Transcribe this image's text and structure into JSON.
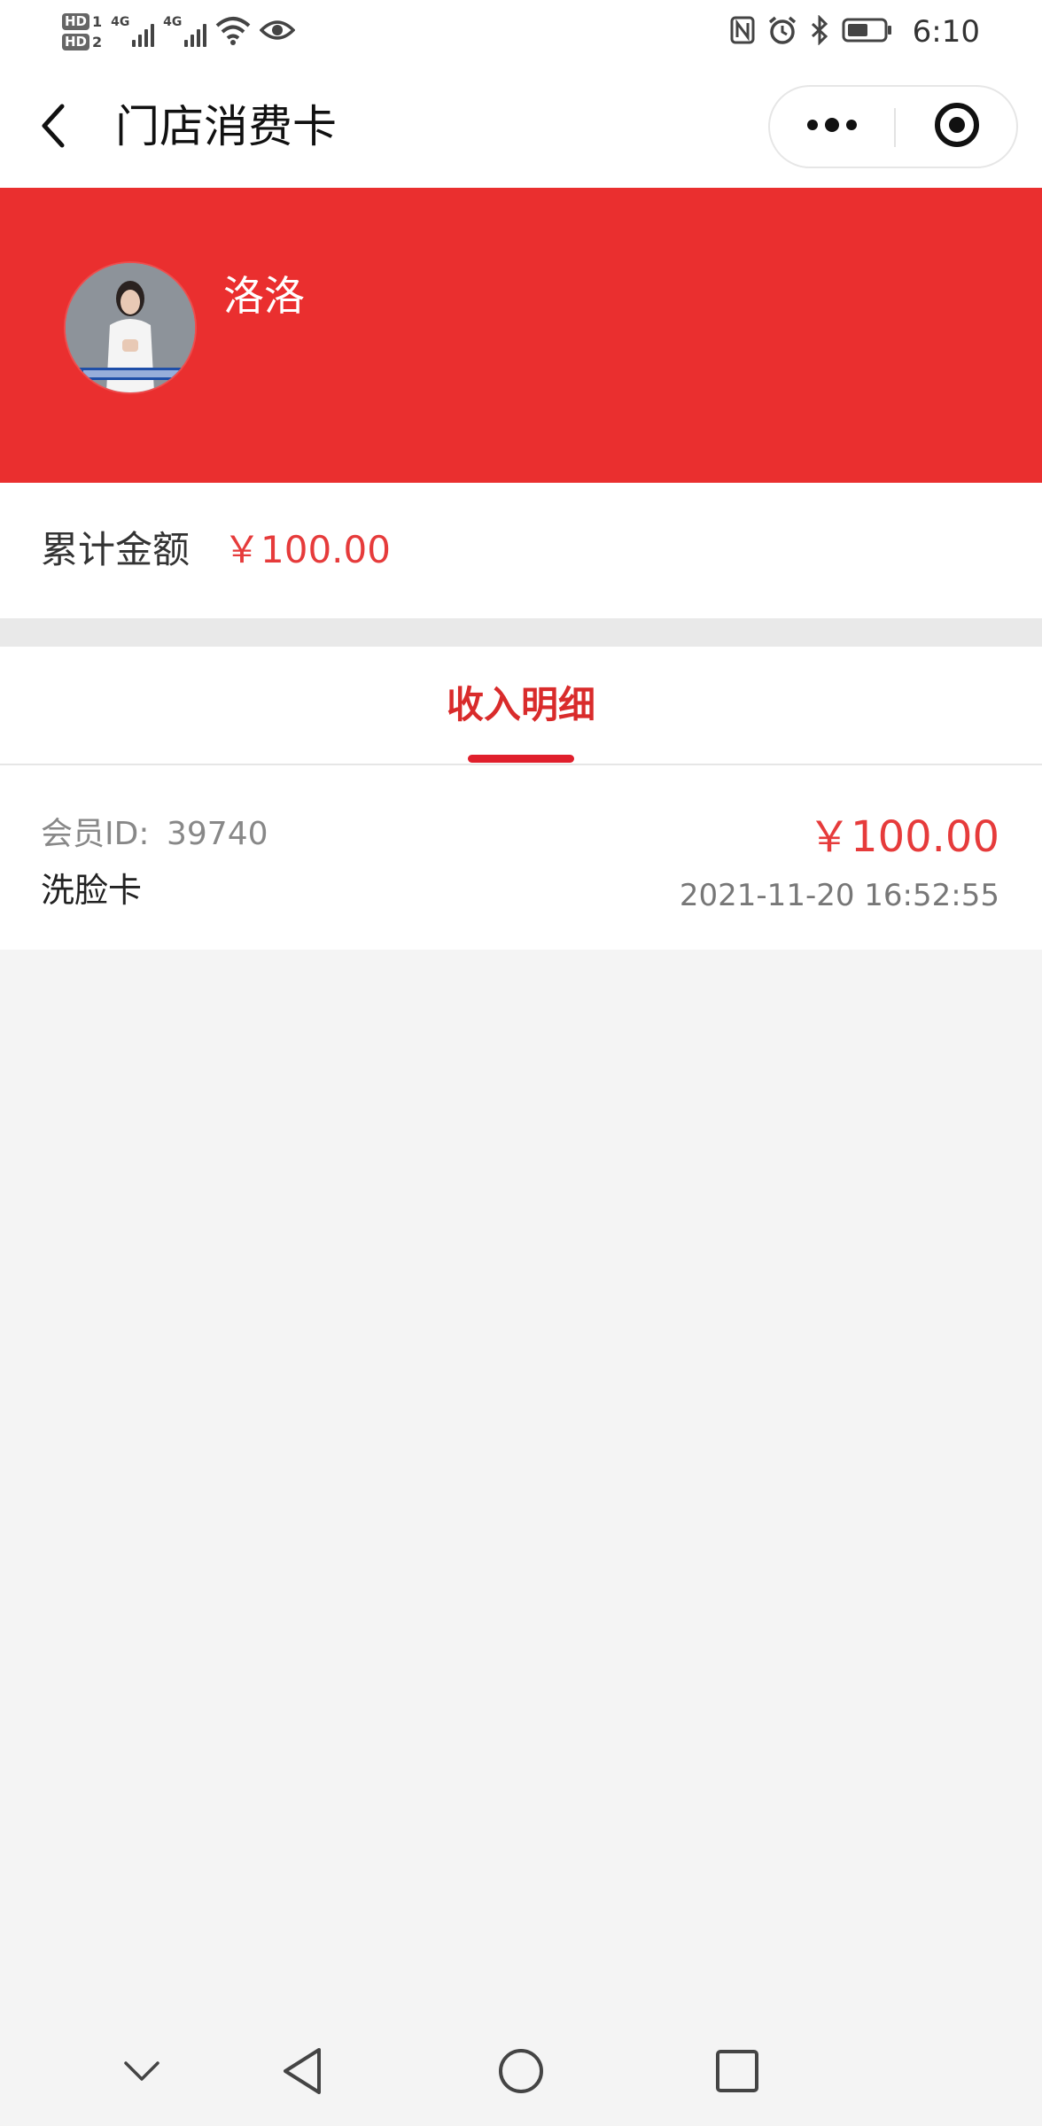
{
  "status_bar": {
    "hd1_label": "HD",
    "hd1_num": "1",
    "hd2_label": "HD",
    "hd2_num": "2",
    "net1": "4G",
    "net2": "4G",
    "time": "6:10"
  },
  "header": {
    "title": "门店消费卡"
  },
  "profile": {
    "name": "洛洛"
  },
  "summary": {
    "label": "累计金额",
    "value": "￥100.00"
  },
  "tabs": [
    {
      "label": "收入明细",
      "active": true
    }
  ],
  "records": [
    {
      "member_label": "会员ID:",
      "member_id": "39740",
      "name": "洗脸卡",
      "amount": "￥100.00",
      "time": "2021-11-20 16:52:55"
    }
  ],
  "colors": {
    "brand_red": "#ea2f2f",
    "accent_red": "#e63b3b",
    "tab_red": "#d92b2b"
  },
  "icons": {
    "back": "chevron-left-icon",
    "more": "more-dots-icon",
    "target": "record-target-icon",
    "nav_down": "chevron-down-icon",
    "nav_back": "triangle-back-icon",
    "nav_home": "circle-home-icon",
    "nav_recent": "square-recent-icon"
  }
}
